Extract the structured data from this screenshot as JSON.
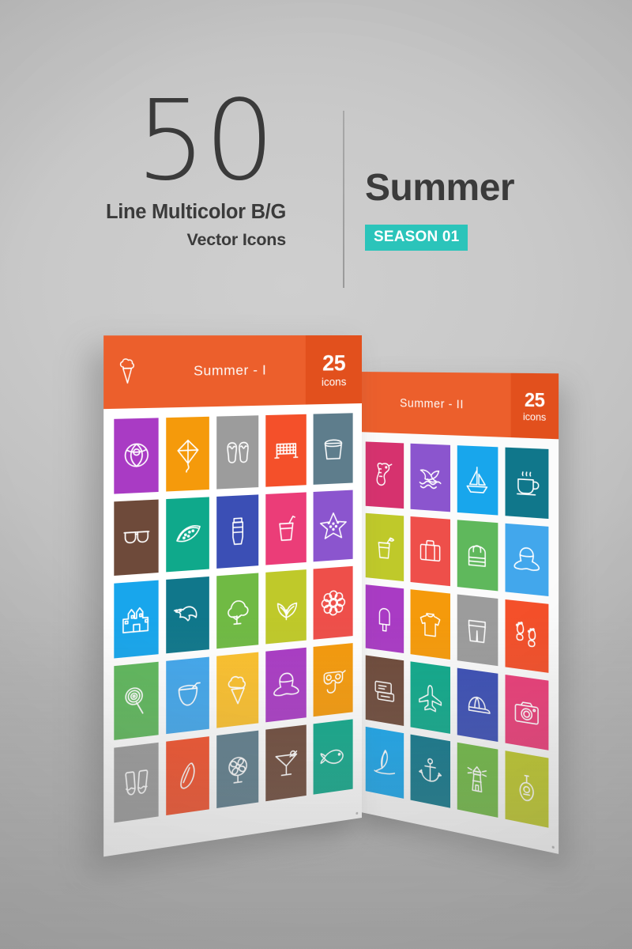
{
  "header": {
    "count": "50",
    "subtitle_line1": "Line Multicolor B/G",
    "subtitle_line2": "Vector Icons",
    "title": "Summer",
    "badge": "SEASON 01",
    "badge_color": "#2BC4BA",
    "text_color": "#3B3B3B"
  },
  "panels": [
    {
      "id": "panel-left",
      "banner_icon": "ice-cream-cone-icon",
      "banner_title": "Summer - I",
      "count_number": "25",
      "count_label": "icons",
      "banner_color": "#EC5F2C",
      "banner_count_color": "#E2501D",
      "columns": 5,
      "icons": [
        {
          "name": "beach-ball-icon",
          "color": "#A93BC4"
        },
        {
          "name": "kite-icon",
          "color": "#F59A0B"
        },
        {
          "name": "flip-flops-icon",
          "color": "#9C9C9C"
        },
        {
          "name": "volleyball-net-icon",
          "color": "#F4502A"
        },
        {
          "name": "sand-bucket-icon",
          "color": "#5E7D8C"
        },
        {
          "name": "sunglasses-icon",
          "color": "#6E4A3A"
        },
        {
          "name": "watermelon-icon",
          "color": "#0FA98B"
        },
        {
          "name": "sunscreen-tube-icon",
          "color": "#3B4FB5"
        },
        {
          "name": "soft-drink-icon",
          "color": "#EB3D78"
        },
        {
          "name": "starfish-icon",
          "color": "#8B55CE"
        },
        {
          "name": "sandcastle-icon",
          "color": "#18A6EC"
        },
        {
          "name": "seagull-icon",
          "color": "#10778B"
        },
        {
          "name": "tree-icon",
          "color": "#70BA44"
        },
        {
          "name": "leaves-icon",
          "color": "#BFC92A"
        },
        {
          "name": "flower-icon",
          "color": "#EE4F4A"
        },
        {
          "name": "lollipop-icon",
          "color": "#5FB85C"
        },
        {
          "name": "coconut-drink-icon",
          "color": "#42A7EC"
        },
        {
          "name": "ice-cream-cone-icon",
          "color": "#FBC02D"
        },
        {
          "name": "sun-hat-icon",
          "color": "#A93BC4"
        },
        {
          "name": "diving-mask-icon",
          "color": "#F59A0B"
        },
        {
          "name": "flippers-icon",
          "color": "#9C9C9C"
        },
        {
          "name": "surfboard-icon",
          "color": "#F4502A"
        },
        {
          "name": "fan-icon",
          "color": "#5E7D8C"
        },
        {
          "name": "cocktail-icon",
          "color": "#6E4A3A"
        },
        {
          "name": "fish-icon",
          "color": "#0FA98B"
        }
      ]
    },
    {
      "id": "panel-right",
      "banner_title": "Summer - II",
      "count_number": "25",
      "count_label": "icons",
      "banner_color": "#EC5F2C",
      "banner_count_color": "#E2501D",
      "columns": 4,
      "icons": [
        {
          "name": "seahorse-icon",
          "color": "#D6326E"
        },
        {
          "name": "dolphin-icon",
          "color": "#8B55CE"
        },
        {
          "name": "sailboat-icon",
          "color": "#18A6EC"
        },
        {
          "name": "hot-coffee-icon",
          "color": "#10778B"
        },
        {
          "name": "juice-glass-icon",
          "color": "#BFC92A"
        },
        {
          "name": "suitcase-icon",
          "color": "#EE4F4A"
        },
        {
          "name": "backpack-icon",
          "color": "#5FB85C"
        },
        {
          "name": "sun-hat-icon",
          "color": "#42A7EC"
        },
        {
          "name": "popsicle-icon",
          "color": "#A93BC4"
        },
        {
          "name": "tshirt-icon",
          "color": "#F59A0B"
        },
        {
          "name": "shorts-icon",
          "color": "#9C9C9C"
        },
        {
          "name": "footprints-icon",
          "color": "#F4502A"
        },
        {
          "name": "ticket-stack-icon",
          "color": "#6E4A3A"
        },
        {
          "name": "airplane-icon",
          "color": "#0FA98B"
        },
        {
          "name": "cap-icon",
          "color": "#3B4FB5"
        },
        {
          "name": "camera-icon",
          "color": "#EB3D78"
        },
        {
          "name": "windsurf-icon",
          "color": "#18A6EC"
        },
        {
          "name": "anchor-icon",
          "color": "#10778B"
        },
        {
          "name": "lighthouse-icon",
          "color": "#70BA44"
        },
        {
          "name": "ukulele-icon",
          "color": "#BFC92A"
        }
      ]
    }
  ]
}
